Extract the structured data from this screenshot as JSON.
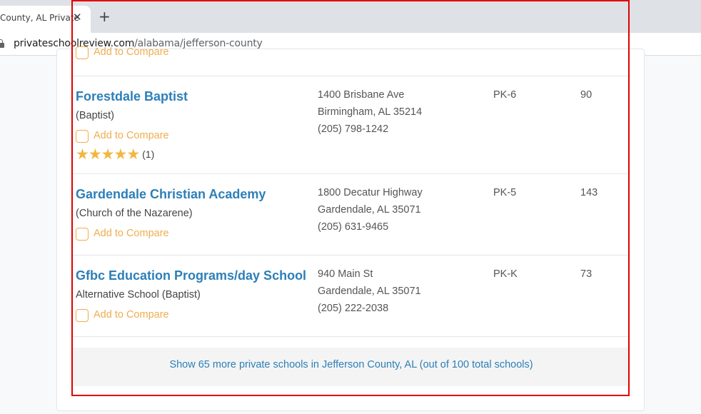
{
  "browser": {
    "tab_title": "County, AL Private",
    "tab_close": "✕",
    "new_tab": "+",
    "url_host": "privateschoolreview.com",
    "url_path": "/alabama/jefferson-county"
  },
  "partial_top": {
    "compare_label": "Add to Compare"
  },
  "schools": [
    {
      "name": "Forestdale Baptist",
      "type": "(Baptist)",
      "compare_label": "Add to Compare",
      "address_line1": "1400 Brisbane Ave",
      "address_line2": "Birmingham, AL 35214",
      "phone": "(205) 798-1242",
      "grades": "PK-6",
      "students": "90",
      "rating": 5,
      "review_count": "(1)"
    },
    {
      "name": "Gardendale Christian Academy",
      "type": "(Church of the Nazarene)",
      "compare_label": "Add to Compare",
      "address_line1": "1800 Decatur Highway",
      "address_line2": "Gardendale, AL 35071",
      "phone": "(205) 631-9465",
      "grades": "PK-5",
      "students": "143"
    },
    {
      "name": "Gfbc Education Programs/day School",
      "type": "Alternative School (Baptist)",
      "compare_label": "Add to Compare",
      "address_line1": "940 Main St",
      "address_line2": "Gardendale, AL 35071",
      "phone": "(205) 222-2038",
      "grades": "PK-K",
      "students": "73"
    }
  ],
  "show_more": "Show 65 more private schools in Jefferson County, AL (out of 100 total schools)",
  "colors": {
    "link": "#2d7fb8",
    "compare": "#f0ad4e",
    "star": "#f4b63f",
    "highlight_frame": "#e00000"
  }
}
